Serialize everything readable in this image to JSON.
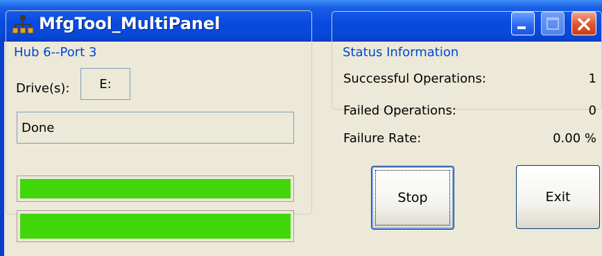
{
  "window": {
    "title": "MfgTool_MultiPanel",
    "icon": "network-hub-icon",
    "controls": [
      "minimize",
      "maximize",
      "close"
    ]
  },
  "hub_panel": {
    "group_label": "Hub 6--Port 3",
    "drive_label": "Drive(s):",
    "drive_value": "E:",
    "status_text": "Done",
    "progress_bars": [
      {
        "value_percent": 100
      },
      {
        "value_percent": 100
      }
    ],
    "progress_color": "#41d60a"
  },
  "status_panel": {
    "group_label": "Status Information",
    "rows": [
      {
        "label": "Successful Operations:",
        "value": "1"
      },
      {
        "label": "Failed Operations:",
        "value": "0"
      },
      {
        "label": "Failure Rate:",
        "value": "0.00 %"
      }
    ]
  },
  "buttons": {
    "stop_label": "Stop",
    "exit_label": "Exit"
  },
  "colors": {
    "titlebar": "#0a4ae0",
    "group_label": "#0046d5",
    "dialog_background": "#ece9d8"
  }
}
